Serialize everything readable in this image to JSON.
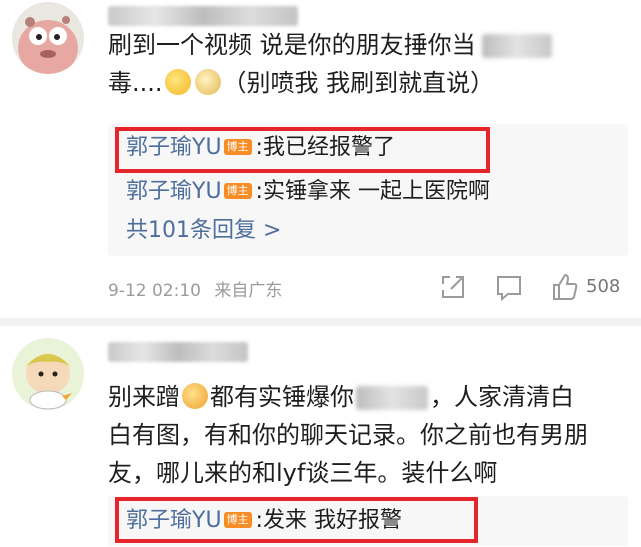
{
  "comments": [
    {
      "username": "",
      "lines": [
        "刷到一个视频 说是你的朋友捶你当",
        "毒....",
        "（别喷我 我刷到就直说）"
      ],
      "replies": [
        {
          "name": "郭子瑜YU",
          "badge": "博主",
          "text": ":我已经报警了"
        },
        {
          "name": "郭子瑜YU",
          "badge": "博主",
          "text": ":实锤拿来 一起上医院啊"
        }
      ],
      "more_replies": "共101条回复 >",
      "time": "9-12 02:10",
      "source": "来自广东",
      "likes": "508"
    },
    {
      "username": "",
      "lines": [
        "别来蹭",
        "都有实锤爆你",
        "，人家清清白",
        "白有图，有和你的聊天记录。你之前也有男朋",
        "友，哪儿来的和lyf谈三年。装什么啊"
      ],
      "replies": [
        {
          "name": "郭子瑜YU",
          "badge": "博主",
          "text": ":发来 我好报警"
        }
      ]
    }
  ],
  "icons": [
    "share-icon",
    "comment-icon",
    "like-icon"
  ],
  "colors": {
    "highlight": "#e5252a",
    "link": "#4d6e9c",
    "badge": "#f88d26",
    "meta": "#9b9b9b"
  }
}
